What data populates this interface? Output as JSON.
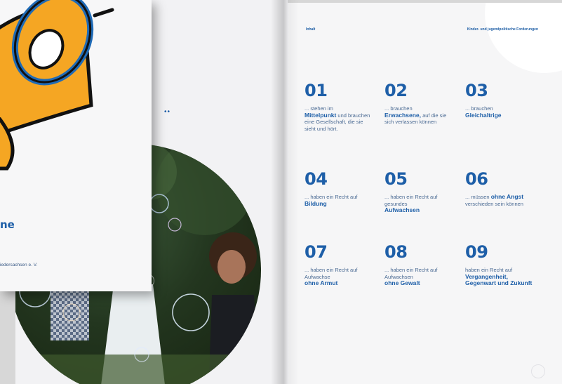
{
  "cover": {
    "title_fragment": "ne",
    "org_fragment": "iedersachsen e. V.",
    "dots": "••"
  },
  "header": {
    "left": "Inhalt",
    "right": "Kinder- und jugendpolitische Forderungen"
  },
  "items": [
    {
      "num": "01",
      "pre": "... stehen im",
      "bold": "Mittelpunkt",
      "post": " und brauchen eine Gesellschaft, die sie sieht und hört."
    },
    {
      "num": "02",
      "pre": "... brauchen",
      "bold": "Erwachsene,",
      "post": " auf die sie sich verlassen können"
    },
    {
      "num": "03",
      "pre": "... brauchen",
      "bold": "Gleichaltrige",
      "post": ""
    },
    {
      "num": "04",
      "pre": "... haben ein Recht auf ",
      "bold": "Bildung",
      "post": ""
    },
    {
      "num": "05",
      "pre": "... haben ein Recht auf gesundes",
      "bold": "Aufwachsen",
      "post": ""
    },
    {
      "num": "06",
      "pre": "... müssen ",
      "bold": "ohne Angst",
      "post": " verschieden sein können"
    },
    {
      "num": "07",
      "pre": "... haben ein Recht auf Aufwachse",
      "bold": "ohne Armut",
      "post": ""
    },
    {
      "num": "08",
      "pre": "... haben ein Recht auf Aufwachsen",
      "bold": "ohne Gewalt",
      "post": ""
    },
    {
      "num": "09",
      "pre": "haben ein Recht auf",
      "bold": "Vergangenheit, Gegenwart und Zukunft",
      "post": ""
    }
  ],
  "colors": {
    "accent": "#1e5fa8",
    "megaphone_orange": "#f5a623",
    "megaphone_ring": "#1f6bb7"
  }
}
